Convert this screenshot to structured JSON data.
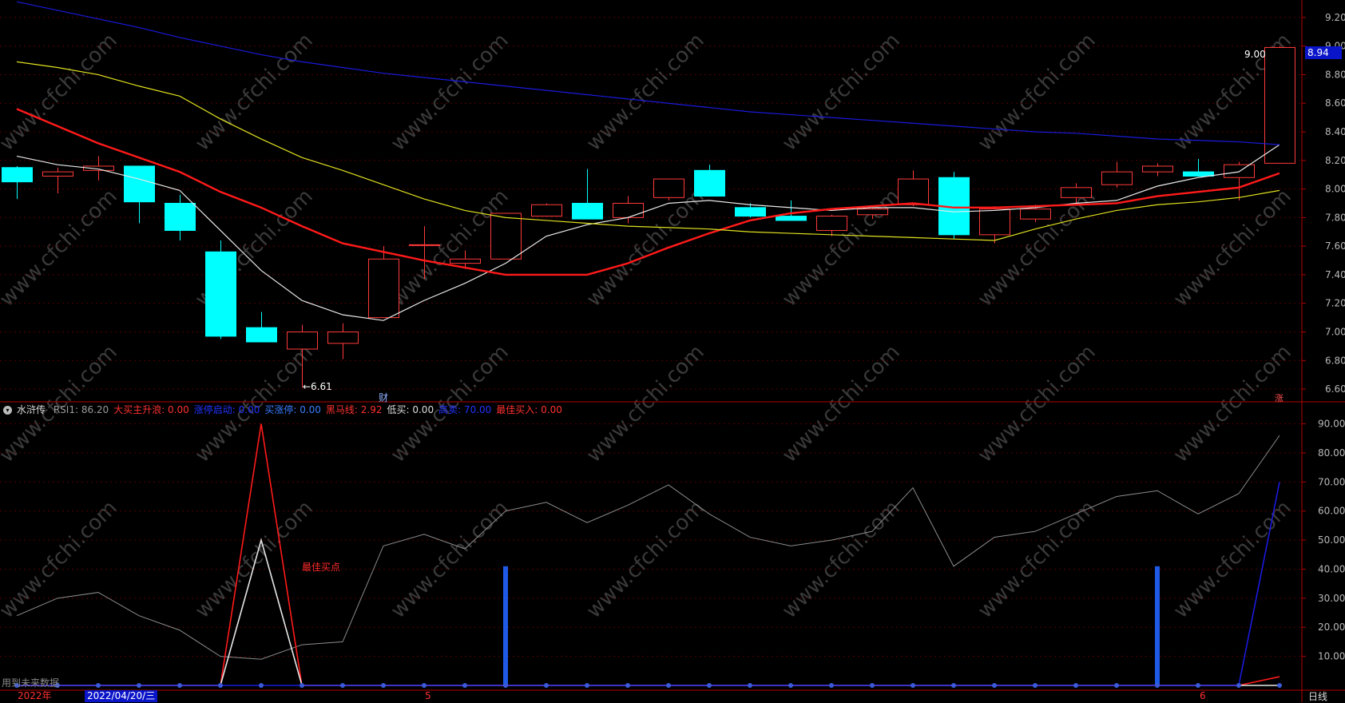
{
  "colors": {
    "bull": "#ff3a3a",
    "bear": "#00ffff",
    "ma_white": "#e8e8e8",
    "ma_red": "#ff1a1a",
    "ma_yellow": "#e0e020",
    "ma_blue": "#1a1adc",
    "rsi_gray": "#8c8c8c",
    "axis": "#b40000",
    "grid": "#550000",
    "blue_bar": "#1e5ae6",
    "watermark": "#3a3a3a"
  },
  "watermark_text": "www.cfchi.com",
  "price_labels": {
    "high_marker": "9.00",
    "low_marker": "←6.61",
    "current_price": "8.94",
    "cai_marker": "财",
    "zhang_marker": "涨"
  },
  "indicator_bar": {
    "name": "水浒传",
    "items": [
      {
        "label": "RSI1: 86.20",
        "color": "#9a9a9a"
      },
      {
        "label": "大买主升浪: 0.00",
        "color": "#ff3030"
      },
      {
        "label": "涨停启动: 0.00",
        "color": "#2233ff"
      },
      {
        "label": "买涨停: 0.00",
        "color": "#3a7dff"
      },
      {
        "label": "黑马线: 2.92",
        "color": "#ff3030"
      },
      {
        "label": "低买: 0.00",
        "color": "#dddddd"
      },
      {
        "label": "高卖: 70.00",
        "color": "#2233ff"
      },
      {
        "label": "最佳买入: 0.00",
        "color": "#ff3030"
      }
    ]
  },
  "best_buy_label": "最佳买点",
  "future_note": "用到未来数据",
  "date_axis": {
    "labels": [
      "2022年",
      "2022/04/20/三",
      "5",
      "6"
    ]
  },
  "period_label": "日线",
  "chart_data": [
    {
      "type": "candlestick",
      "title": "",
      "y_ticks": [
        "9.20",
        "9.00",
        "8.80",
        "8.60",
        "8.40",
        "8.20",
        "8.00",
        "7.80",
        "7.60",
        "7.40",
        "7.20",
        "7.00",
        "6.80",
        "6.60"
      ],
      "ylim": [
        6.55,
        9.3
      ],
      "candles": [
        {
          "o": 8.15,
          "h": 8.16,
          "l": 7.93,
          "c": 8.05
        },
        {
          "o": 8.09,
          "h": 8.15,
          "l": 7.97,
          "c": 8.12
        },
        {
          "o": 8.13,
          "h": 8.23,
          "l": 8.06,
          "c": 8.16
        },
        {
          "o": 8.16,
          "h": 8.16,
          "l": 7.76,
          "c": 7.91
        },
        {
          "o": 7.9,
          "h": 7.96,
          "l": 7.64,
          "c": 7.71
        },
        {
          "o": 7.56,
          "h": 7.64,
          "l": 6.95,
          "c": 6.97
        },
        {
          "o": 7.03,
          "h": 7.14,
          "l": 6.93,
          "c": 6.93
        },
        {
          "o": 6.88,
          "h": 7.05,
          "l": 6.61,
          "c": 7.0
        },
        {
          "o": 6.92,
          "h": 7.06,
          "l": 6.81,
          "c": 7.0
        },
        {
          "o": 7.1,
          "h": 7.6,
          "l": 7.1,
          "c": 7.51
        },
        {
          "o": 7.61,
          "h": 7.74,
          "l": 7.37,
          "c": 7.61
        },
        {
          "o": 7.48,
          "h": 7.57,
          "l": 7.44,
          "c": 7.51
        },
        {
          "o": 7.51,
          "h": 7.83,
          "l": 7.51,
          "c": 7.83
        },
        {
          "o": 7.81,
          "h": 7.9,
          "l": 7.81,
          "c": 7.89
        },
        {
          "o": 7.9,
          "h": 8.14,
          "l": 7.8,
          "c": 7.79
        },
        {
          "o": 7.8,
          "h": 7.95,
          "l": 7.76,
          "c": 7.9
        },
        {
          "o": 7.94,
          "h": 8.07,
          "l": 7.92,
          "c": 8.07
        },
        {
          "o": 8.13,
          "h": 8.17,
          "l": 7.95,
          "c": 7.95
        },
        {
          "o": 7.87,
          "h": 7.9,
          "l": 7.8,
          "c": 7.81
        },
        {
          "o": 7.81,
          "h": 7.92,
          "l": 7.79,
          "c": 7.78
        },
        {
          "o": 7.71,
          "h": 7.82,
          "l": 7.67,
          "c": 7.81
        },
        {
          "o": 7.82,
          "h": 7.87,
          "l": 7.79,
          "c": 7.86
        },
        {
          "o": 7.89,
          "h": 8.13,
          "l": 7.88,
          "c": 8.07
        },
        {
          "o": 8.08,
          "h": 8.12,
          "l": 7.65,
          "c": 7.68
        },
        {
          "o": 7.68,
          "h": 7.88,
          "l": 7.62,
          "c": 7.86
        },
        {
          "o": 7.79,
          "h": 7.89,
          "l": 7.77,
          "c": 7.86
        },
        {
          "o": 7.94,
          "h": 8.04,
          "l": 7.89,
          "c": 8.01
        },
        {
          "o": 8.03,
          "h": 8.19,
          "l": 8.01,
          "c": 8.12
        },
        {
          "o": 8.12,
          "h": 8.18,
          "l": 8.09,
          "c": 8.16
        },
        {
          "o": 8.12,
          "h": 8.21,
          "l": 8.09,
          "c": 8.09
        },
        {
          "o": 8.08,
          "h": 8.19,
          "l": 7.92,
          "c": 8.17
        },
        {
          "o": 8.18,
          "h": 9.0,
          "l": 8.18,
          "c": 8.99
        }
      ],
      "ma_series": [
        {
          "color": "ma_white",
          "values": [
            8.23,
            8.17,
            8.14,
            8.07,
            7.99,
            7.71,
            7.43,
            7.22,
            7.12,
            7.08,
            7.22,
            7.34,
            7.48,
            7.67,
            7.75,
            7.8,
            7.9,
            7.92,
            7.89,
            7.87,
            7.85,
            7.87,
            7.87,
            7.84,
            7.85,
            7.87,
            7.9,
            7.92,
            8.02,
            8.08,
            8.12,
            8.31
          ]
        },
        {
          "color": "ma_red",
          "values": [
            8.56,
            8.44,
            8.32,
            8.22,
            8.12,
            7.98,
            7.87,
            7.74,
            7.62,
            7.56,
            7.5,
            7.45,
            7.4,
            7.4,
            7.4,
            7.48,
            7.59,
            7.69,
            7.78,
            7.83,
            7.86,
            7.88,
            7.9,
            7.87,
            7.87,
            7.88,
            7.89,
            7.9,
            7.95,
            7.98,
            8.01,
            8.11
          ]
        },
        {
          "color": "ma_yellow",
          "values": [
            8.89,
            8.85,
            8.8,
            8.72,
            8.65,
            8.49,
            8.35,
            8.22,
            8.13,
            8.03,
            7.93,
            7.85,
            7.8,
            7.78,
            7.76,
            7.74,
            7.73,
            7.72,
            7.7,
            7.69,
            7.68,
            7.67,
            7.66,
            7.65,
            7.64,
            7.72,
            7.79,
            7.85,
            7.89,
            7.91,
            7.94,
            7.99
          ]
        },
        {
          "color": "ma_blue",
          "values": [
            9.31,
            9.25,
            9.19,
            9.13,
            9.06,
            9.0,
            8.94,
            8.89,
            8.85,
            8.81,
            8.78,
            8.75,
            8.72,
            8.69,
            8.66,
            8.63,
            8.6,
            8.57,
            8.54,
            8.52,
            8.5,
            8.48,
            8.46,
            8.44,
            8.42,
            8.4,
            8.39,
            8.37,
            8.35,
            8.34,
            8.33,
            8.31
          ]
        }
      ]
    },
    {
      "type": "line",
      "title": "",
      "y_ticks": [
        "90.00",
        "80.00",
        "70.00",
        "60.00",
        "50.00",
        "40.00",
        "30.00",
        "20.00",
        "10.00"
      ],
      "ylim": [
        0,
        94
      ],
      "series": [
        {
          "color": "rsi_gray",
          "values": [
            24,
            30,
            32,
            24,
            19,
            10,
            9,
            14,
            15,
            48,
            52,
            47,
            60,
            63,
            56,
            62,
            69,
            59,
            51,
            48,
            50,
            53,
            68,
            41,
            51,
            53,
            59,
            65,
            67,
            59,
            66,
            86
          ]
        },
        {
          "color": "ma_red",
          "values": [
            0,
            0,
            0,
            0,
            0,
            0,
            90,
            0,
            0,
            0,
            0,
            0,
            0,
            0,
            0,
            0,
            0,
            0,
            0,
            0,
            0,
            0,
            0,
            0,
            0,
            0,
            0,
            0,
            0,
            0,
            0,
            3
          ]
        },
        {
          "color": "ma_white",
          "values": [
            0,
            0,
            0,
            0,
            0,
            0,
            50,
            0,
            0,
            0,
            0,
            0,
            0,
            0,
            0,
            0,
            0,
            0,
            0,
            0,
            0,
            0,
            0,
            0,
            0,
            0,
            0,
            0,
            0,
            0,
            0,
            0
          ]
        },
        {
          "color": "ma_blue",
          "values": [
            0,
            0,
            0,
            0,
            0,
            0,
            0,
            0,
            0,
            0,
            0,
            0,
            0,
            0,
            0,
            0,
            0,
            0,
            0,
            0,
            0,
            0,
            0,
            0,
            0,
            0,
            0,
            0,
            0,
            0,
            0,
            70
          ]
        }
      ],
      "bars": [
        {
          "index": 12,
          "value": 41
        },
        {
          "index": 28,
          "value": 41
        }
      ]
    }
  ]
}
